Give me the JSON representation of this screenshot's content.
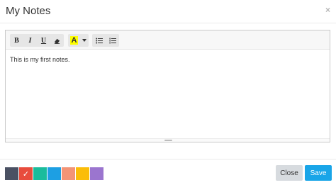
{
  "modal": {
    "title": "My Notes",
    "close_glyph": "×"
  },
  "toolbar": {
    "bold_label": "B",
    "italic_label": "I",
    "underline_label": "U",
    "color_label": "A",
    "highlight_color": "#ffff00"
  },
  "editor": {
    "content": "This is my first notes."
  },
  "colors": {
    "swatches": [
      {
        "color": "#4a5163",
        "selected": false
      },
      {
        "color": "#e84c3d",
        "selected": true,
        "check": "✓"
      },
      {
        "color": "#1abc9c",
        "selected": false
      },
      {
        "color": "#1d9fe3",
        "selected": false
      },
      {
        "color": "#f39476",
        "selected": false
      },
      {
        "color": "#fbbd08",
        "selected": false
      },
      {
        "color": "#9b75cf",
        "selected": false
      }
    ]
  },
  "footer": {
    "close_label": "Close",
    "save_label": "Save"
  }
}
